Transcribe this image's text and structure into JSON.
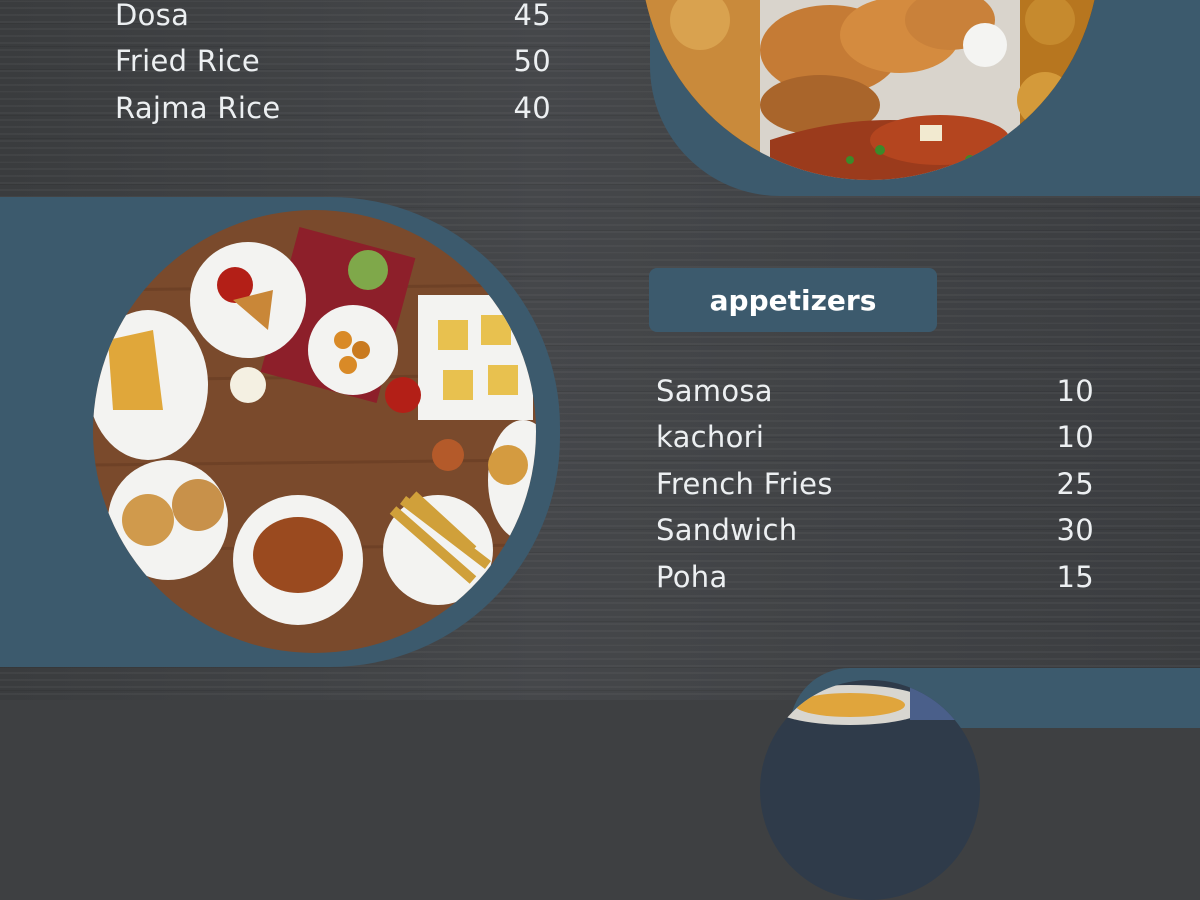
{
  "top_menu": {
    "items": [
      {
        "name": "Dosa",
        "price": "45"
      },
      {
        "name": "Fried Rice",
        "price": "50"
      },
      {
        "name": "Rajma Rice",
        "price": "40"
      }
    ]
  },
  "appetizers": {
    "title": "appetizers",
    "items": [
      {
        "name": "Samosa",
        "price": "10"
      },
      {
        "name": "kachori",
        "price": "10"
      },
      {
        "name": "French Fries",
        "price": "25"
      },
      {
        "name": "Sandwich",
        "price": "30"
      },
      {
        "name": "Poha",
        "price": "15"
      }
    ]
  },
  "colors": {
    "background": "#3e4042",
    "accent_panel": "#3c5a6d",
    "text": "#eceff1"
  }
}
